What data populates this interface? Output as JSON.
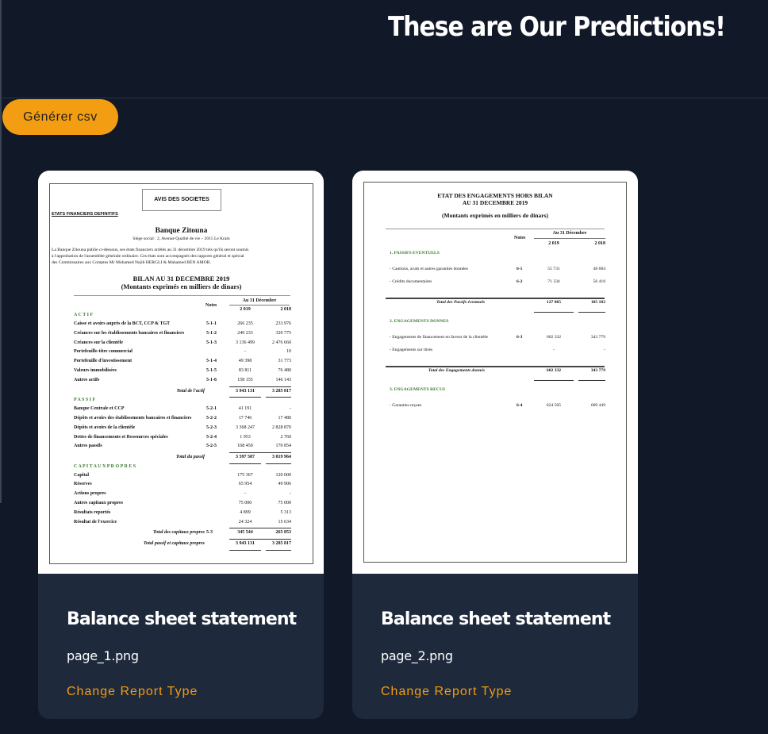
{
  "header": {
    "title": "These are Our Predictions!"
  },
  "toolbar": {
    "csv_label": "Générer csv"
  },
  "cards": [
    {
      "title": "Balance sheet statement",
      "file": "page_1.png",
      "link": "Change Report Type",
      "doc": {
        "box_title": "AVIS DES SOCIETES",
        "section": "ETATS FINANCIERS DEFINITIFS",
        "bank": "Banque Zitouna",
        "address": "Siège social : 2,  Avenue Qualité de vie  – 2015 Le Kram",
        "para": [
          "La Banque Zitouna publie ci-dessous, ses états financiers arrêtés au 31 décembre 2019 tels qu'ils seront soumis",
          "à l'approbation de l'assemblée générale ordinaire. Ces états sont accompagnés des rapports général et spécial",
          "des Commissaires aux Comptes Mr Mohamed Nejib HERGLI & Mahamed BEN AMOR."
        ],
        "heading1": "BILAN AU 31 DECEMBRE 2019",
        "heading2": "(Montants exprimés en milliers de dinars)",
        "col_notes": "Notes",
        "col_period": "Au 31 Décembre",
        "col_y1": "2 019",
        "col_y2": "2 018",
        "rows": [
          [
            "A C T I F",
            "",
            "",
            "",
            "sec"
          ],
          [
            "Caisse et avoirs auprès de la BCT, CCP & TGT",
            "5-1-1",
            "266 235",
            "233 976",
            ""
          ],
          [
            "Créances sur les établissements bancaires et financiers",
            "5-1-2",
            "249 233",
            "320 775",
            ""
          ],
          [
            "Créances sur la clientèle",
            "5-1-3",
            "3 136 499",
            "2 476 660",
            ""
          ],
          [
            "Portefeuille-titre commercial",
            "",
            "-",
            "10",
            ""
          ],
          [
            "Portefeuille d'investissement",
            "5-1-4",
            "49 398",
            "31 773",
            ""
          ],
          [
            "Valeurs immobilisées",
            "5-1-5",
            "83 811",
            "76 480",
            ""
          ],
          [
            "Autres actifs",
            "5-1-6",
            "158 155",
            "146 143",
            ""
          ],
          [
            "Total de l'actif",
            "",
            "3 943 131",
            "3 285 817",
            "tot"
          ],
          [
            "P A S S I F",
            "",
            "",
            "",
            "sec"
          ],
          [
            "Banque Centrale et CCP",
            "5-2-1",
            "41 191",
            "-",
            ""
          ],
          [
            "Dépôts et avoirs des établissements bancaires et financiers",
            "5-2-2",
            "17 746",
            "17 480",
            ""
          ],
          [
            "Dépôts et avoirs de la clientèle",
            "5-2-3",
            "3 368 247",
            "2 828 870",
            ""
          ],
          [
            "Dettes de financements et Ressources spéciales",
            "5-2-4",
            "1 953",
            "2 760",
            ""
          ],
          [
            "Autres passifs",
            "5-2-5",
            "168 450",
            "170 854",
            ""
          ],
          [
            "Total du passif",
            "",
            "3 597 587",
            "3 019 964",
            "tot"
          ],
          [
            "C A P I T A U X   P R O P R E S",
            "",
            "",
            "",
            "sec"
          ],
          [
            "Capital",
            "",
            "175 367",
            "120 000",
            ""
          ],
          [
            "Réserves",
            "",
            "65 954",
            "49 906",
            ""
          ],
          [
            "Actions propres",
            "",
            "-",
            "-",
            ""
          ],
          [
            "Autres capitaux propres",
            "",
            "75 000",
            "75 000",
            ""
          ],
          [
            "Résultats reportés",
            "",
            "4 899",
            "5 313",
            ""
          ],
          [
            "Résultat de l'exercice",
            "",
            "24 324",
            "15 634",
            ""
          ],
          [
            "Total des capitaux propres",
            "5-3",
            "345 544",
            "265 853",
            "tot"
          ],
          [
            "Total passif et capitaux propres",
            "",
            "3 943 131",
            "3 285 817",
            "tot"
          ]
        ]
      }
    },
    {
      "title": "Balance sheet statement",
      "file": "page_2.png",
      "link": "Change Report Type",
      "doc": {
        "heading1": "ETAT DES ENGAGEMENTS HORS BILAN",
        "heading2": "AU 31 DECEMBRE 2019",
        "heading3": "(Montants exprimés en milliers de dinars)",
        "col_notes": "Notes",
        "col_period": "Au 31 Décembre",
        "col_y1": "2 019",
        "col_y2": "2 018",
        "rows": [
          [
            "1. PASSIFS EVENTUELS",
            "",
            "",
            "",
            "sec"
          ],
          [
            "- Cautions, avals et autres garanties données",
            "6-1",
            "55 731",
            "48 684",
            ""
          ],
          [
            "- Crédits documentaires",
            "6-2",
            "71 334",
            "56 418",
            ""
          ],
          [
            "Total des Passifs éventuels",
            "",
            "127 065",
            "105 102",
            "tot"
          ],
          [
            "2. ENGAGEMENTS DONNES",
            "",
            "",
            "",
            "sec"
          ],
          [
            "- Engagements de financement en faveur de la clientèle",
            "6-3",
            "602 332",
            "343 779",
            ""
          ],
          [
            "- Engagements sur titres",
            "",
            "-",
            "-",
            ""
          ],
          [
            "Total des Engagements donnés",
            "",
            "602 332",
            "343 779",
            "tot"
          ],
          [
            "3. ENGAGEMENTS RECUS",
            "",
            "",
            "",
            "sec"
          ],
          [
            "- Garanties reçues",
            "6-4",
            "824 505",
            "609 449",
            ""
          ]
        ]
      }
    }
  ]
}
